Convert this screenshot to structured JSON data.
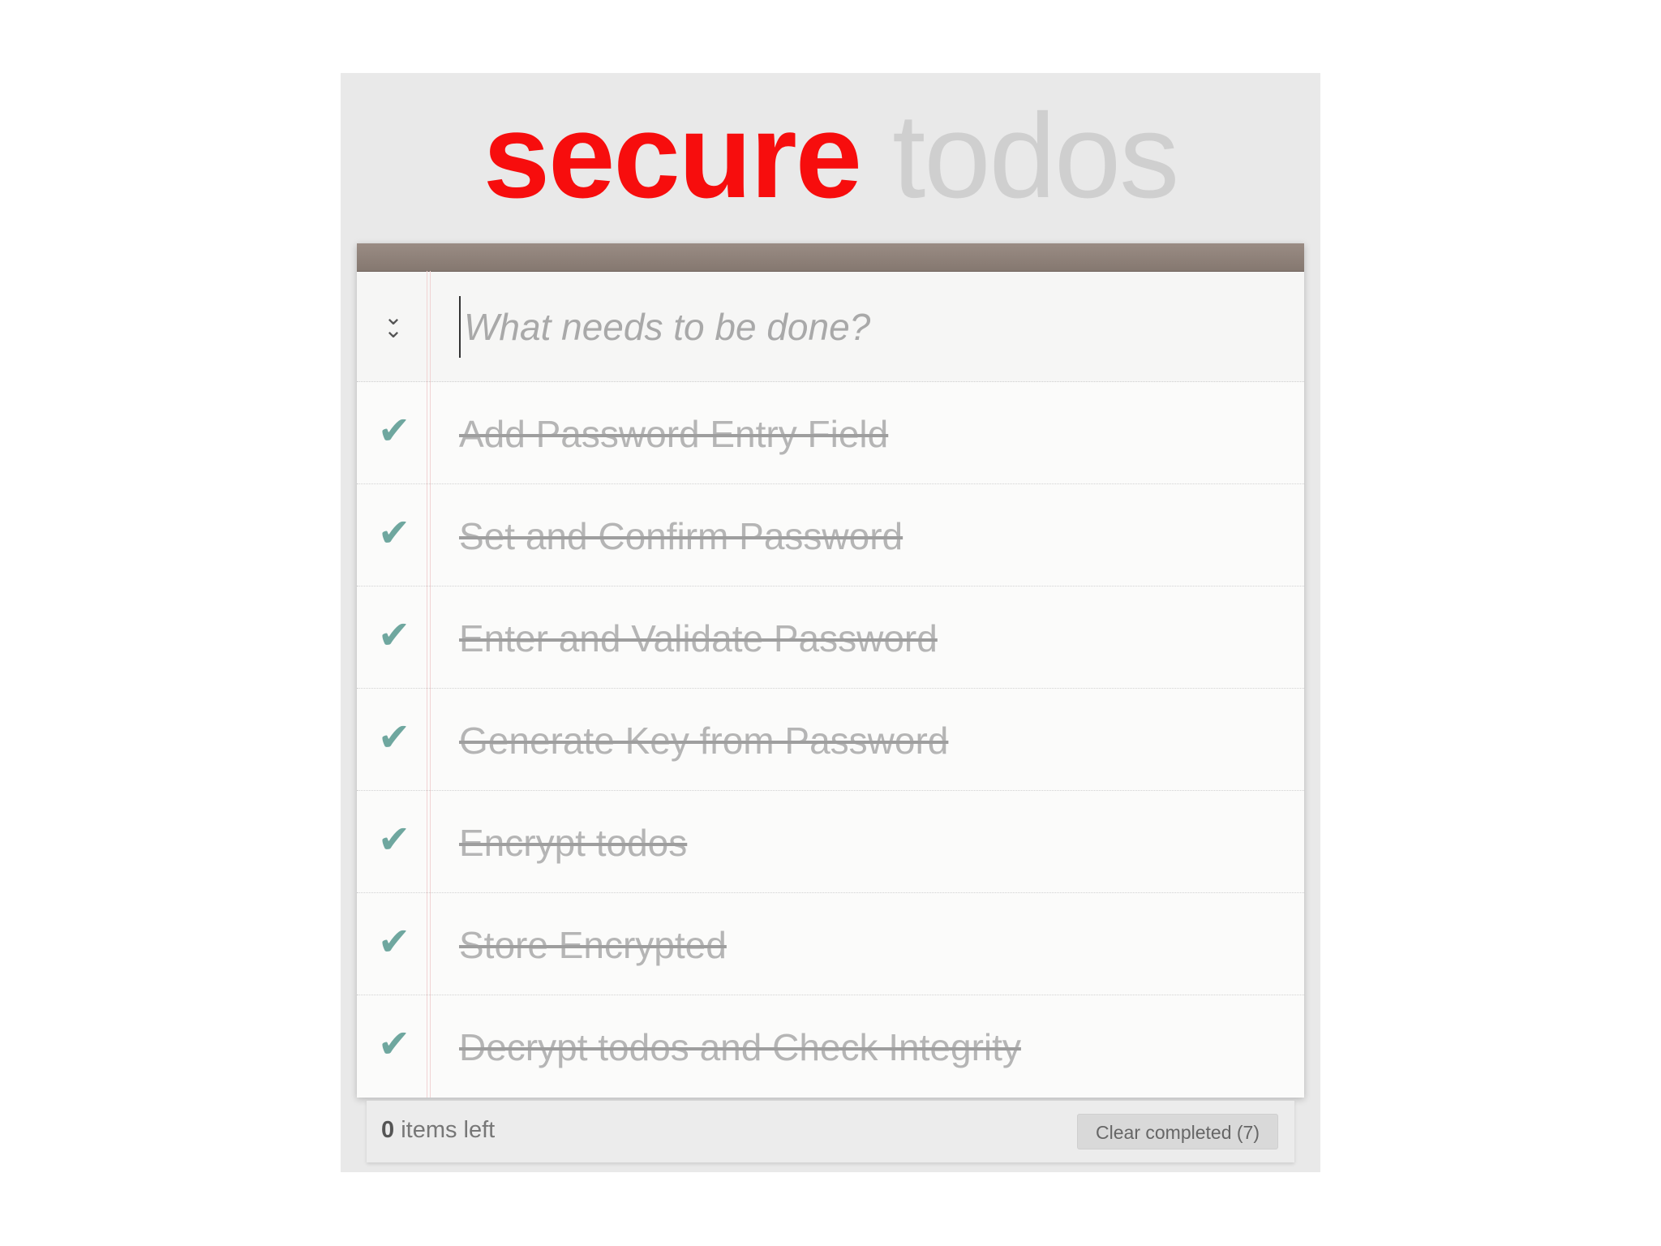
{
  "header": {
    "title_word_1": "secure",
    "title_word_2": "todos"
  },
  "new_todo": {
    "placeholder": "What needs to be done?",
    "value": "",
    "toggle_all_icon": "double-chevron-down-icon"
  },
  "todos": [
    {
      "label": "Add Password Entry Field",
      "completed": true
    },
    {
      "label": "Set and Confirm Password",
      "completed": true
    },
    {
      "label": "Enter and Validate Password",
      "completed": true
    },
    {
      "label": "Generate Key from Password",
      "completed": true
    },
    {
      "label": "Encrypt todos",
      "completed": true
    },
    {
      "label": "Store Encrypted",
      "completed": true
    },
    {
      "label": "Decrypt todos and Check Integrity",
      "completed": true
    }
  ],
  "footer": {
    "items_left_count": "0",
    "items_left_label": "items left",
    "clear_completed_label": "Clear completed (7)"
  },
  "colors": {
    "title_primary": "#f70d0d",
    "title_secondary": "#cfcfcf",
    "checkmark": "#6fa79f",
    "topbar": "#8f827a"
  }
}
